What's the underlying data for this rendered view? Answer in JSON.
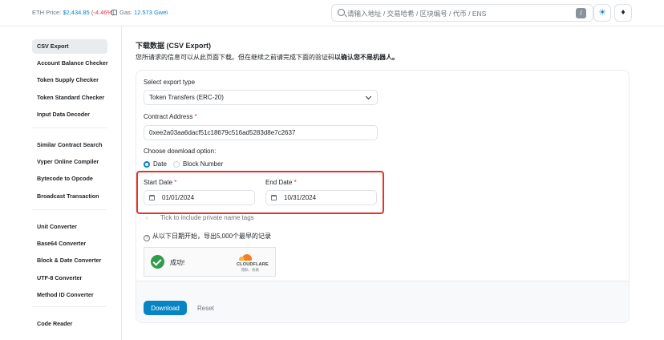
{
  "header": {
    "eth_price_label": "ETH Price:",
    "eth_price_value": "$2,434.85",
    "eth_price_change": "(-4.46%)",
    "gas_label": "Gas:",
    "gas_value": "12.573 Gwei",
    "search_placeholder": "请输入地址 / 交易哈希 / 区块编号 / 代币 / ENS",
    "search_shortcut": "/",
    "theme_glyph": "☀",
    "eth_glyph": "♦"
  },
  "sidebar": {
    "groups": [
      [
        "CSV Export",
        "Account Balance Checker",
        "Token Supply Checker",
        "Token Standard Checker",
        "Input Data Decoder"
      ],
      [
        "Similar Contract Search",
        "Vyper Online Compiler",
        "Bytecode to Opcode",
        "Broadcast Transaction"
      ],
      [
        "Unit Converter",
        "Base64 Converter",
        "Block & Date Converter",
        "UTF-8 Converter",
        "Method ID Converter"
      ],
      [
        "Code Reader"
      ]
    ],
    "active": "CSV Export"
  },
  "main": {
    "title": "下载数据 (CSV Export)",
    "desc_prefix": "您所请求的信息可以从此页面下载。但在继续之前请完成下面的验证码",
    "desc_bold": "以确认您不是机器人。",
    "export_type_label": "Select export type",
    "export_type_value": "Token Transfers (ERC-20)",
    "contract_label": "Contract Address",
    "required_mark": "*",
    "contract_value": "0xee2a03aa6dacf51c18679c516ad5283d8e7c2637",
    "download_option_label": "Choose download option:",
    "option_date": "Date",
    "option_block": "Block Number",
    "start_date_label": "Start Date",
    "start_date_value": "01/01/2024",
    "end_date_label": "End Date",
    "end_date_value": "10/31/2024",
    "private_tags_label": "Tick to include private name tags",
    "info_text": "从以下日期开始，导出5,000个最早的记录",
    "info_glyph": "?",
    "captcha_status": "成功!",
    "captcha_brand": "CLOUDFLARE",
    "captcha_legal": "隐私 · 条款",
    "download_button": "Download",
    "reset_button": "Reset"
  },
  "colors": {
    "accent": "#0784c3",
    "negative": "#dc3545",
    "highlight_border": "#e5332a",
    "success": "#2e9c48"
  }
}
